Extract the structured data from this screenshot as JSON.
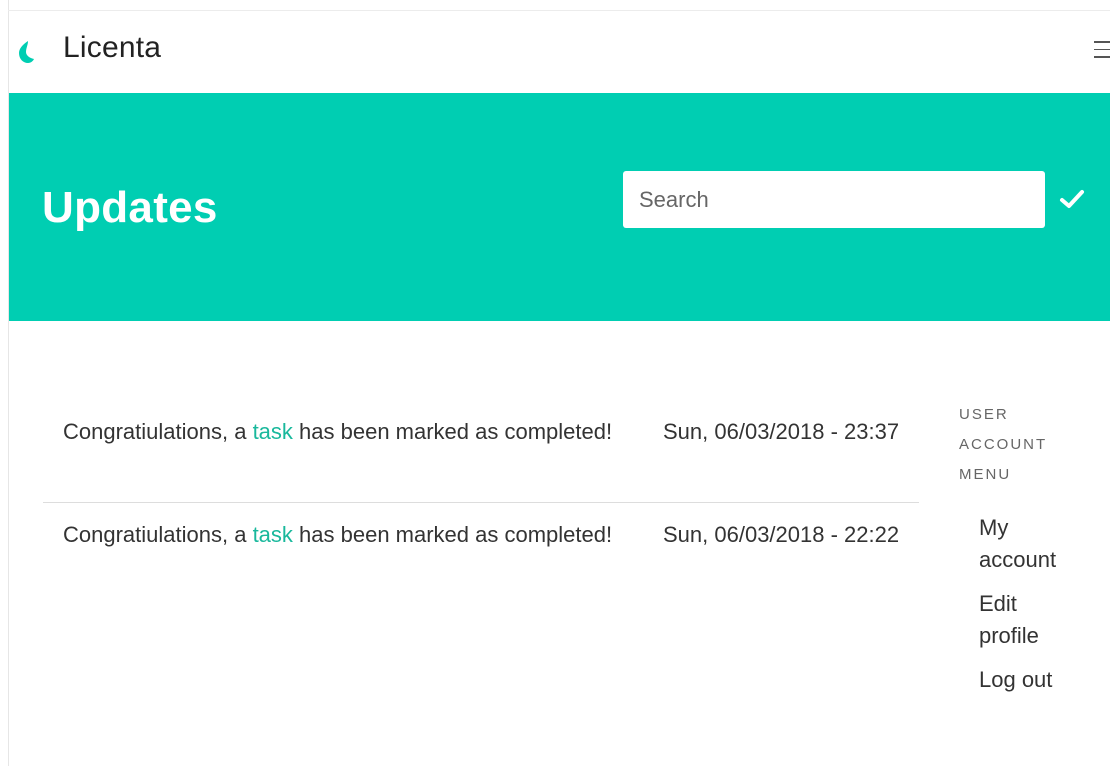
{
  "site": {
    "name": "Licenta"
  },
  "hero": {
    "title": "Updates",
    "search_placeholder": "Search",
    "search_value": ""
  },
  "updates": [
    {
      "message_before": "Congratiulations, a ",
      "link_text": "task",
      "message_after": " has been marked as completed!",
      "date": "Sun, 06/03/2018 - 23:37"
    },
    {
      "message_before": "Congratiulations, a ",
      "link_text": "task",
      "message_after": " has been marked as completed!",
      "date": "Sun, 06/03/2018 - 22:22"
    }
  ],
  "account_menu": {
    "title": "User account menu",
    "items": [
      {
        "label": "My account"
      },
      {
        "label": "Edit profile"
      },
      {
        "label": "Log out"
      }
    ]
  },
  "icons": {
    "logo": "drop-logo-icon",
    "menu": "hamburger-menu-icon",
    "search_submit": "checkmark-icon"
  },
  "colors": {
    "accent": "#00ceb2",
    "link": "#19b89c",
    "text": "#333333"
  }
}
